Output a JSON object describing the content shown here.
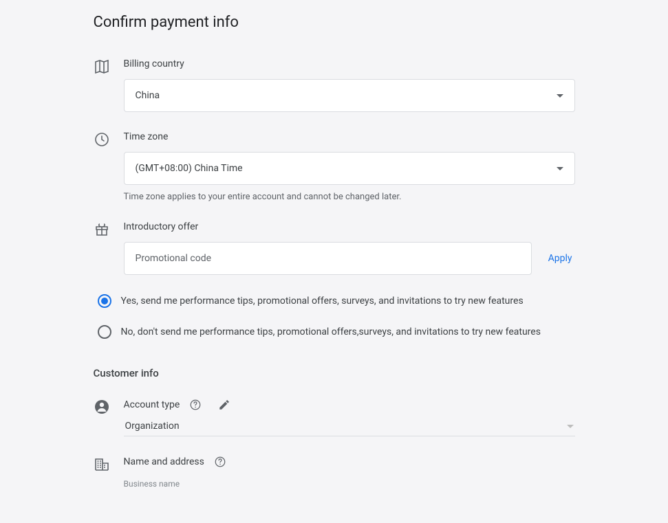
{
  "page": {
    "title": "Confirm payment info"
  },
  "billing": {
    "label": "Billing country",
    "value": "China"
  },
  "timezone": {
    "label": "Time zone",
    "value": "(GMT+08:00) China Time",
    "helper": "Time zone applies to your entire account and cannot be changed later."
  },
  "offer": {
    "label": "Introductory offer",
    "placeholder": "Promotional code",
    "apply": "Apply"
  },
  "optin": {
    "yes": "Yes, send me performance tips, promotional offers, surveys, and invitations to try new features",
    "no": "No, don't send me performance tips, promotional offers,surveys, and invitations to try new features"
  },
  "customer": {
    "section_title": "Customer info",
    "account_type_label": "Account type",
    "account_type_value": "Organization",
    "name_address_label": "Name and address",
    "business_name_label": "Business name"
  }
}
